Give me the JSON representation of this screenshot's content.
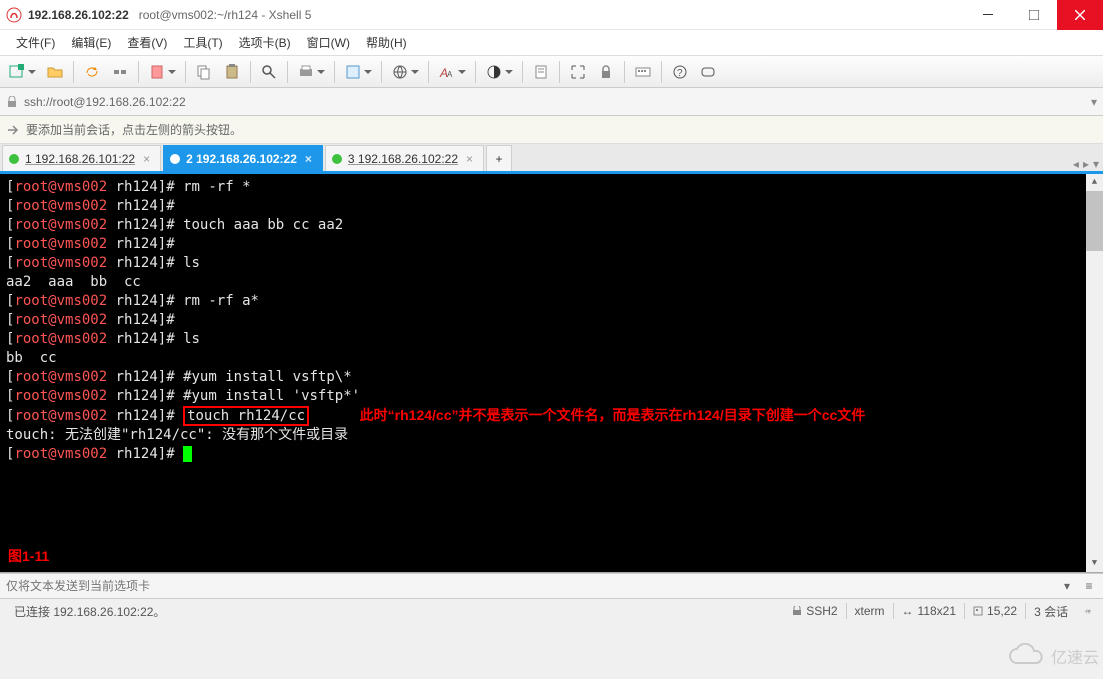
{
  "window": {
    "address_bold": "192.168.26.102:22",
    "caption": "root@vms002:~/rh124 - Xshell 5"
  },
  "menu": {
    "file": "文件(F)",
    "edit": "编辑(E)",
    "view": "查看(V)",
    "tools": "工具(T)",
    "tabs": "选项卡(B)",
    "window": "窗口(W)",
    "help": "帮助(H)"
  },
  "addressbar": {
    "url": "ssh://root@192.168.26.102:22"
  },
  "tipbar": {
    "text": "要添加当前会话，点击左侧的箭头按钮。"
  },
  "session_tabs": [
    {
      "label": "1 192.168.26.101:22",
      "active": false
    },
    {
      "label": "2 192.168.26.102:22",
      "active": true
    },
    {
      "label": "3 192.168.26.102:22",
      "active": false
    }
  ],
  "terminal": {
    "lines": [
      {
        "t": "p",
        "cmd": "rm -rf *"
      },
      {
        "t": "p",
        "cmd": ""
      },
      {
        "t": "p",
        "cmd": "touch aaa bb cc aa2"
      },
      {
        "t": "p",
        "cmd": ""
      },
      {
        "t": "p",
        "cmd": "ls"
      },
      {
        "t": "o",
        "text": "aa2  aaa  bb  cc"
      },
      {
        "t": "p",
        "cmd": "rm -rf a*"
      },
      {
        "t": "p",
        "cmd": ""
      },
      {
        "t": "p",
        "cmd": "ls"
      },
      {
        "t": "o",
        "text": "bb  cc"
      },
      {
        "t": "p",
        "cmd": "#yum install vsftp\\*"
      },
      {
        "t": "p",
        "cmd": "#yum install 'vsftp*'"
      },
      {
        "t": "pbox",
        "cmd": "touch rh124/cc",
        "note": "此时“rh124/cc”并不是表示一个文件名，而是表示在rh124/目录下创建一个cc文件"
      },
      {
        "t": "o",
        "text": "touch: 无法创建\"rh124/cc\": 没有那个文件或目录"
      },
      {
        "t": "pcur",
        "cmd": ""
      }
    ],
    "prompt_user": "root",
    "prompt_host": "vms002",
    "prompt_path": "rh124",
    "figure_label": "图1-11"
  },
  "inputstrip": {
    "placeholder": "仅将文本发送到当前选项卡"
  },
  "status": {
    "connected": "已连接 192.168.26.102:22。",
    "proto": "SSH2",
    "termtype": "xterm",
    "size": "118x21",
    "cursor": "15,22",
    "sessions": "3 会话"
  },
  "watermark": {
    "text": "亿速云"
  }
}
